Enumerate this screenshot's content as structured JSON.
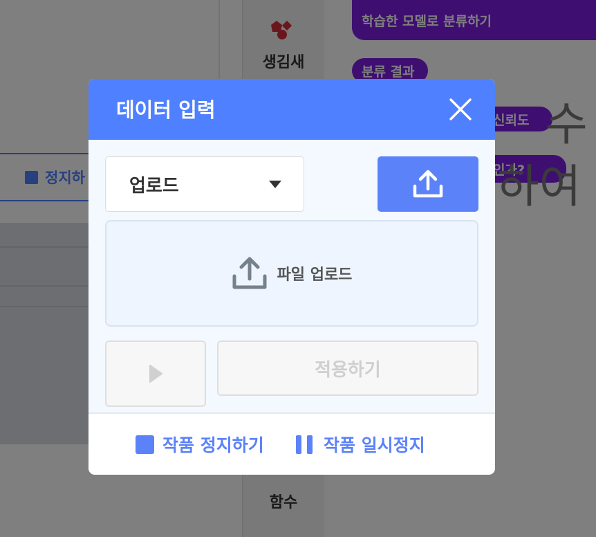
{
  "background": {
    "stop_label": "정지하",
    "category_top": "생김새",
    "category_bottom": "함수",
    "block_classify": "학습한 모델로 분류하기",
    "block_result": "분류 결과",
    "block_confidence": "신뢰도",
    "block_question": "인가?",
    "big_text_1": "수",
    "big_text_2": "하여"
  },
  "modal": {
    "title": "데이터 입력",
    "select_value": "업로드",
    "dropzone_label": "파일 업로드",
    "apply_label": "적용하기",
    "footer": {
      "stop_label": "작품 정지하기",
      "pause_label": "작품 일시정지"
    }
  },
  "colors": {
    "primary": "#4f80ff",
    "button": "#5b82f8",
    "block": "#7d1fe0"
  }
}
